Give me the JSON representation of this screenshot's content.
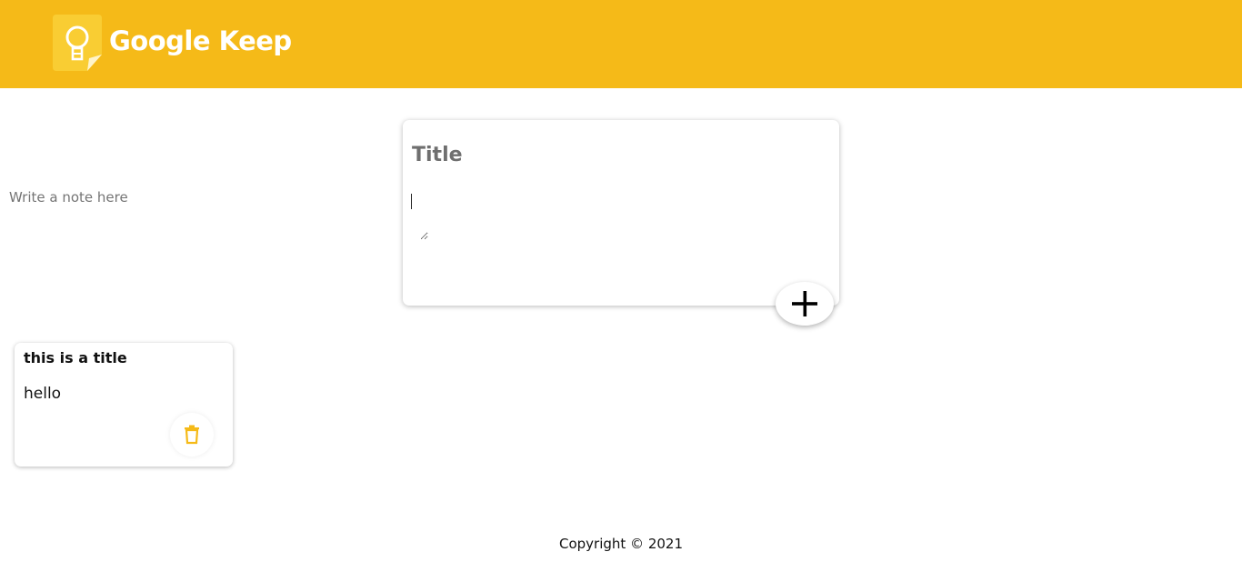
{
  "header": {
    "app_title": "Google Keep",
    "logo_icon": "lightbulb-note-icon",
    "background_color": "#f5ba18"
  },
  "create_note": {
    "title_placeholder": "Title",
    "content_placeholder": "Write a note here",
    "add_icon": "plus-icon"
  },
  "notes": [
    {
      "title": "this is a title",
      "content": "hello",
      "delete_icon": "trash-icon"
    }
  ],
  "footer": {
    "copyright": "Copyright © 2021"
  },
  "colors": {
    "accent": "#f5ba18",
    "text": "#111111"
  }
}
